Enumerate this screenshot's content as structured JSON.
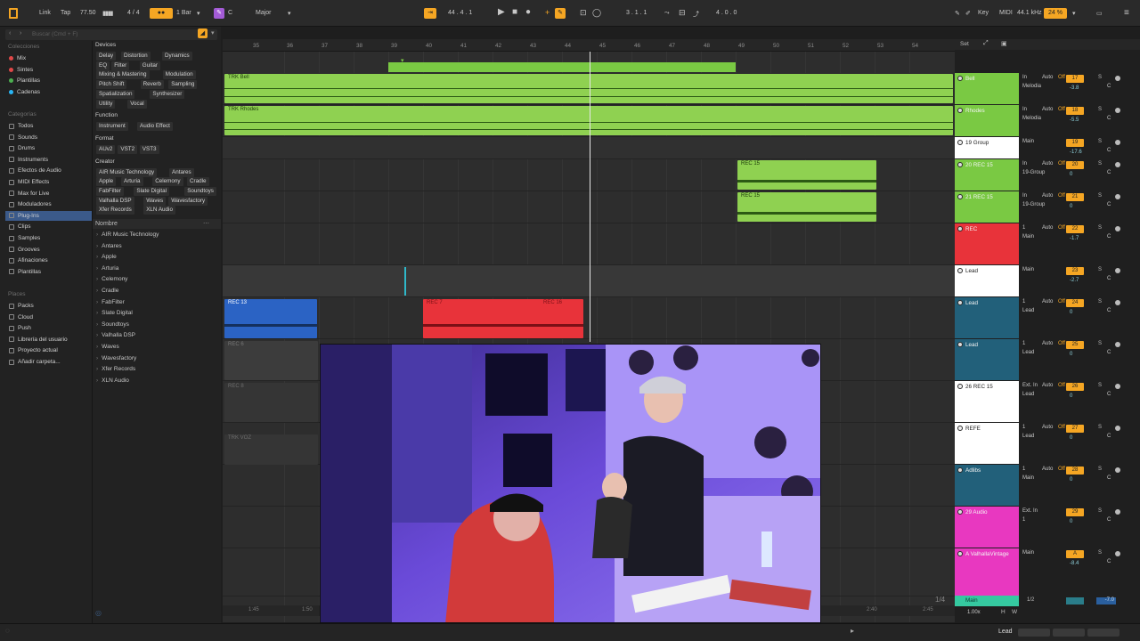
{
  "top_bar": {
    "link": "Link",
    "tap": "Tap",
    "tempo": "77.50",
    "time_signature": "4 / 4",
    "quantize": "1 Bar",
    "key_root": "C",
    "key_scale": "Major",
    "position": "44 . 4 . 1",
    "loop_start": "3 . 1 . 1",
    "loop_length": "4 . 0 . 0",
    "key_label": "Key",
    "midi_label": "MIDI",
    "sample_rate": "44.1 kHz",
    "cpu": "24 %",
    "accent": "#f5a623",
    "key_color": "#a35bd6"
  },
  "browser": {
    "search_placeholder": "Buscar (Cmd + F)",
    "collections_title": "Colecciones",
    "collections": [
      {
        "label": "Mix",
        "color": "#e04848"
      },
      {
        "label": "Sintes",
        "color": "#e04848"
      },
      {
        "label": "Plantillas",
        "color": "#4caf50"
      },
      {
        "label": "Cadenas",
        "color": "#29b6f6"
      }
    ],
    "categories_title": "Categorías",
    "categories": [
      "Todos",
      "Sounds",
      "Drums",
      "Instruments",
      "Efectos de Audio",
      "MIDI Effects",
      "Max for Live",
      "Moduladores",
      "Plug-Ins",
      "Clips",
      "Samples",
      "Grooves",
      "Afinaciones",
      "Plantillas"
    ],
    "places_title": "Places",
    "places": [
      "Packs",
      "Cloud",
      "Push",
      "Librería del usuario",
      "Proyecto actual",
      "Añadir carpeta..."
    ],
    "filters": {
      "devices_label": "Devices",
      "devices_rows": [
        [
          "Delay",
          "Distortion",
          "Dynamics"
        ],
        [
          "EQ",
          "Filter",
          "Guitar"
        ],
        [
          "Mixing & Mastering",
          "Modulation"
        ],
        [
          "Pitch Shift",
          "Reverb",
          "Sampling"
        ],
        [
          "Spatialization",
          "Synthesizer"
        ],
        [
          "Utility",
          "Vocal"
        ]
      ],
      "function_label": "Function",
      "function_rows": [
        [
          "Instrument",
          "Audio Effect"
        ]
      ],
      "format_label": "Format",
      "format_rows": [
        [
          "AUv2",
          "VST2",
          "VST3"
        ]
      ],
      "creator_label": "Creator",
      "creator_rows": [
        [
          "AIR Music Technology",
          "Antares"
        ],
        [
          "Apple",
          "Arturia",
          "Celemony",
          "Cradle"
        ],
        [
          "FabFilter",
          "Slate Digital",
          "Soundtoys"
        ],
        [
          "Valhalla DSP",
          "Waves",
          "Wavesfactory"
        ],
        [
          "Xfer Records",
          "XLN Audio"
        ]
      ]
    },
    "name_header": "Nombre",
    "plugin_list": [
      "AIR Music Technology",
      "Antares",
      "Apple",
      "Arturia",
      "Celemony",
      "Cradle",
      "FabFilter",
      "Slate Digital",
      "Soundtoys",
      "Valhalla DSP",
      "Waves",
      "Wavesfactory",
      "Xfer Records",
      "XLN Audio"
    ]
  },
  "arrangement": {
    "ruler": [
      "36",
      "37",
      "38",
      "39",
      "40",
      "41",
      "42",
      "43",
      "44",
      "45",
      "46",
      "47",
      "48",
      "49",
      "50",
      "51",
      "52",
      "53",
      "54"
    ],
    "ruler_start": "35",
    "clips": {
      "bell": "TRK Bell",
      "rhodes": "TRK Rhodes",
      "rec15a": "REC 15",
      "rec15b": "REC 15",
      "rec13": "REC 13",
      "rec7": "REC 7",
      "rec16": "REC 16",
      "rec6": "REC 6",
      "rec8": "REC 8",
      "vox": "TRK VOZ"
    },
    "time_labels": [
      "1:45",
      "1:50",
      "2:40",
      "2:45"
    ],
    "page_indicator": "1/4"
  },
  "tracks": [
    {
      "name": "Bell",
      "color": "#7ac943",
      "input": "In",
      "mode": "Auto",
      "off": "Off",
      "sub": "Melodia",
      "number": "17",
      "vol": "-3.8"
    },
    {
      "name": "Rhodes",
      "color": "#7ac943",
      "input": "In",
      "mode": "Auto",
      "off": "Off",
      "sub": "Melodia",
      "number": "18",
      "vol": "-5.5"
    },
    {
      "name": "19 Group",
      "color": "#ffffff",
      "input": "Main",
      "mode": "",
      "off": "",
      "sub": "",
      "number": "19",
      "vol": "-17.6"
    },
    {
      "name": "20 REC 15",
      "color": "#7ac943",
      "input": "In",
      "mode": "Auto",
      "off": "Off",
      "sub": "19-Group",
      "number": "20",
      "vol": "0"
    },
    {
      "name": "21 REC 15",
      "color": "#7ac943",
      "input": "In",
      "mode": "Auto",
      "off": "Off",
      "sub": "19-Group",
      "number": "21",
      "vol": "0"
    },
    {
      "name": "REC",
      "color": "#e8333a",
      "input": "1",
      "mode": "Auto",
      "off": "Off",
      "sub": "Main",
      "number": "22",
      "vol": "-1.7"
    },
    {
      "name": "Lead",
      "color": "#ffffff",
      "input": "Main",
      "mode": "",
      "off": "",
      "sub": "",
      "number": "23",
      "vol": "-2.7"
    },
    {
      "name": "Lead",
      "color": "#22607a",
      "input": "1",
      "mode": "Auto",
      "off": "Off",
      "sub": "Lead",
      "number": "24",
      "vol": "0"
    },
    {
      "name": "Lead",
      "color": "#22607a",
      "input": "1",
      "mode": "Auto",
      "off": "Off",
      "sub": "Lead",
      "number": "25",
      "vol": "0"
    },
    {
      "name": "26 REC 15",
      "color": "#ffffff",
      "input": "Ext. In",
      "mode": "Auto",
      "off": "Off",
      "sub": "Lead",
      "number": "26",
      "vol": "0"
    },
    {
      "name": "REFE",
      "color": "#ffffff",
      "input": "1",
      "mode": "Auto",
      "off": "Off",
      "sub": "Lead",
      "number": "27",
      "vol": "0"
    },
    {
      "name": "Adlibs",
      "color": "#22607a",
      "input": "1",
      "mode": "Auto",
      "off": "Off",
      "sub": "Main",
      "number": "28",
      "vol": "0"
    },
    {
      "name": "29 Audio",
      "color": "#e838c0",
      "input": "Ext. In",
      "mode": "",
      "off": "",
      "sub": "1",
      "number": "29",
      "vol": "0"
    },
    {
      "name": "A ValhallaVintage",
      "color": "#e838c0",
      "input": "Main",
      "mode": "",
      "off": "",
      "sub": "",
      "number": "A",
      "vol": "-8.4"
    }
  ],
  "main_track": {
    "name": "Main",
    "zoom": "1.00x",
    "routing": "1/2",
    "vol": "-7.0"
  },
  "set_label": "Set",
  "statusbar": {
    "selected": "Lead"
  }
}
